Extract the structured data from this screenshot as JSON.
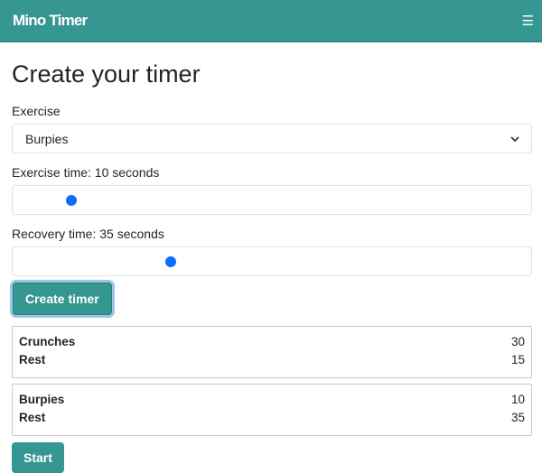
{
  "navbar": {
    "brand": "Mino Timer",
    "menu_icon": "hamburger-icon"
  },
  "page_title": "Create your timer",
  "form": {
    "exercise_label": "Exercise",
    "exercise_value": "Burpies",
    "exercise_time_label": "Exercise time: 10 seconds",
    "exercise_time_fraction": 0.105,
    "recovery_time_label": "Recovery time: 35 seconds",
    "recovery_time_fraction": 0.3,
    "create_button": "Create timer"
  },
  "timers": [
    {
      "exercise": "Crunches",
      "exercise_seconds": "30",
      "rest": "Rest",
      "rest_seconds": "15"
    },
    {
      "exercise": "Burpies",
      "exercise_seconds": "10",
      "rest": "Rest",
      "rest_seconds": "35"
    }
  ],
  "start_button": "Start",
  "colors": {
    "brand": "#359692",
    "slider_thumb": "#0d6efd"
  }
}
